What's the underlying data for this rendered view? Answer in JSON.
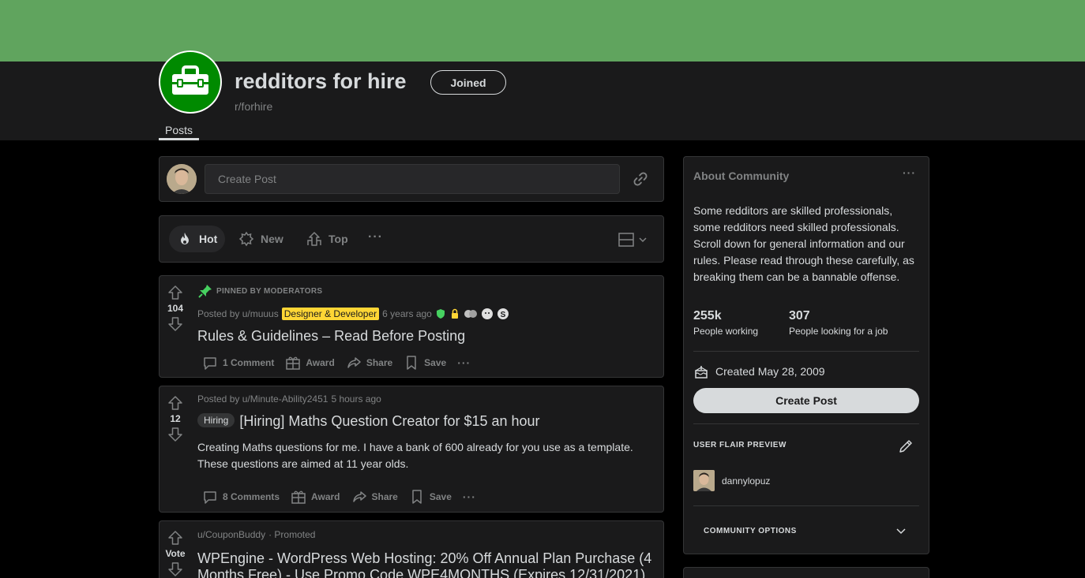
{
  "subreddit": {
    "title": "redditors for hire",
    "name": "r/forhire",
    "joined_label": "Joined",
    "tab_posts": "Posts",
    "banner_color": "#60a45e",
    "icon_color": "#008a00"
  },
  "create_post": {
    "placeholder": "Create Post"
  },
  "sort": {
    "hot": "Hot",
    "new": "New",
    "top": "Top",
    "more": "···"
  },
  "posts": [
    {
      "pinned_label": "PINNED BY MODERATORS",
      "votes": "104",
      "posted_by": "Posted by u/muuus",
      "flair": "Designer & Developer",
      "time": "6 years ago",
      "title": "Rules & Guidelines – Read Before Posting",
      "comments": "1 Comment",
      "award": "Award",
      "share": "Share",
      "save": "Save"
    },
    {
      "votes": "12",
      "posted_by": "Posted by u/Minute-Ability2451",
      "time": "5 hours ago",
      "flair": "Hiring",
      "title": "[Hiring] Maths Question Creator for $15 an hour",
      "body": "Creating Maths questions for me. I have a bank of 600 already for you use as a template. These questions are aimed at 11 year olds.",
      "comments": "8 Comments",
      "award": "Award",
      "share": "Share",
      "save": "Save"
    },
    {
      "votes": "Vote",
      "user": "u/CouponBuddy",
      "promoted": "· Promoted",
      "title_line1": "WPEngine - WordPress Web Hosting: 20% Off Annual Plan Purchase (4",
      "title_line2": "Months Free) - Use Promo Code WPE4MONTHS (Expires 12/31/2021)"
    }
  ],
  "sidebar": {
    "title": "About Community",
    "more": "···",
    "description": "Some redditors are skilled professionals, some redditors need skilled professionals. Scroll down for general information and our rules. Please read through these carefully, as breaking them can be a bannable offense.",
    "members_count": "255k",
    "members_label": "People working",
    "online_count": "307",
    "online_label": "People looking for a job",
    "created": "Created May 28, 2009",
    "create_post": "Create Post",
    "flair_preview_label": "USER FLAIR PREVIEW",
    "username": "dannylopuz",
    "community_options": "COMMUNITY OPTIONS"
  }
}
